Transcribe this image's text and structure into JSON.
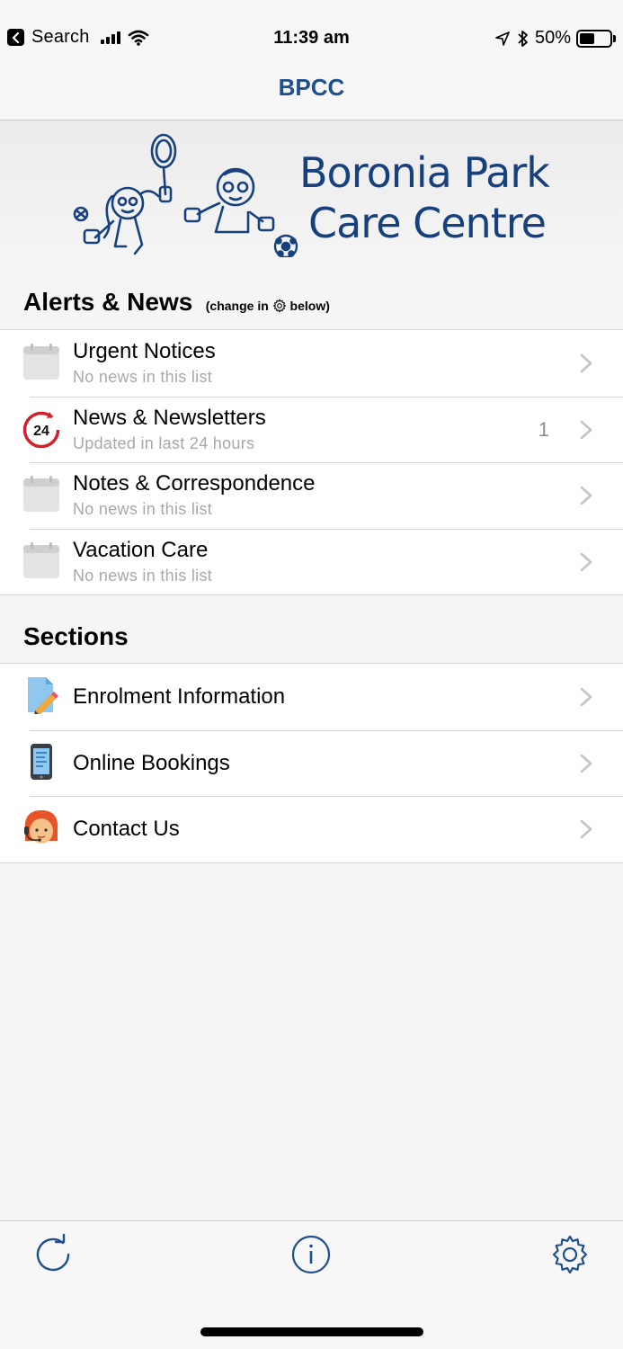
{
  "status_bar": {
    "back_label": "Search",
    "time": "11:39 am",
    "battery_percent": "50%",
    "battery_level": 0.5
  },
  "nav": {
    "title": "BPCC"
  },
  "banner": {
    "logo_line1": "Boronia Park",
    "logo_line2": "Care Centre"
  },
  "alerts": {
    "title": "Alerts & News",
    "note_prefix": "(change in",
    "note_suffix": "below)",
    "items": [
      {
        "title": "Urgent Notices",
        "subtitle": "No news in this list",
        "icon": "calendar-icon",
        "badge": ""
      },
      {
        "title": "News & Newsletters",
        "subtitle": "Updated in last 24 hours",
        "icon": "24-hours-icon",
        "icon_text": "24",
        "badge": "1"
      },
      {
        "title": "Notes & Correspondence",
        "subtitle": "No news in this list",
        "icon": "calendar-icon",
        "badge": ""
      },
      {
        "title": "Vacation Care",
        "subtitle": "No news in this list",
        "icon": "calendar-icon",
        "badge": ""
      }
    ]
  },
  "sections": {
    "title": "Sections",
    "items": [
      {
        "title": "Enrolment Information",
        "icon": "document-pencil-icon"
      },
      {
        "title": "Online Bookings",
        "icon": "tablet-icon"
      },
      {
        "title": "Contact Us",
        "icon": "support-agent-icon"
      }
    ]
  },
  "tab_bar": {
    "icons": [
      "refresh-icon",
      "info-icon",
      "gear-icon"
    ]
  },
  "colors": {
    "accent": "#1e4f8f",
    "logo": "#17407e",
    "alert_red": "#d0202a"
  }
}
